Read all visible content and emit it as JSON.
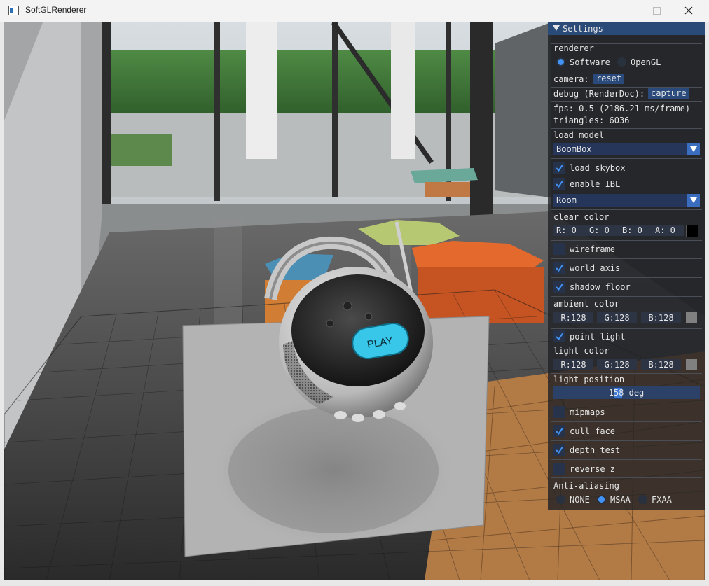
{
  "window": {
    "title": "SoftGLRenderer"
  },
  "settings": {
    "title": "Settings",
    "renderer": {
      "label": "renderer",
      "options": [
        {
          "label": "Software",
          "selected": true
        },
        {
          "label": "OpenGL",
          "selected": false
        }
      ]
    },
    "camera": {
      "label": "camera:",
      "button": "reset"
    },
    "debug": {
      "label": "debug (RenderDoc):",
      "button": "capture"
    },
    "fps": "fps: 0.5 (2186.21 ms/frame)",
    "triangles": "triangles: 6036",
    "load_model": {
      "label": "load model",
      "value": "BoomBox"
    },
    "load_skybox": {
      "label": "load skybox",
      "checked": true
    },
    "enable_ibl": {
      "label": "enable IBL",
      "checked": true
    },
    "skybox": {
      "value": "Room"
    },
    "clear_color": {
      "label": "clear color",
      "r": "R:  0",
      "g": "G:  0",
      "b": "B:  0",
      "a": "A:  0",
      "swatch": "#000000"
    },
    "wireframe": {
      "label": "wireframe",
      "checked": false
    },
    "world_axis": {
      "label": "world axis",
      "checked": true
    },
    "shadow_floor": {
      "label": "shadow floor",
      "checked": true
    },
    "ambient_color": {
      "label": "ambient color",
      "r": "R:128",
      "g": "G:128",
      "b": "B:128",
      "swatch": "#808080"
    },
    "point_light": {
      "label": "point light",
      "checked": true
    },
    "light_color": {
      "label": "light color",
      "r": "R:128",
      "g": "G:128",
      "b": "B:128",
      "swatch": "#808080"
    },
    "light_position": {
      "label": "light position",
      "value": "158 deg",
      "fraction": 0.44
    },
    "mipmaps": {
      "label": "mipmaps",
      "checked": false
    },
    "cull_face": {
      "label": "cull face",
      "checked": true
    },
    "depth_test": {
      "label": "depth test",
      "checked": true
    },
    "reverse_z": {
      "label": "reverse z",
      "checked": false
    },
    "anti_aliasing": {
      "label": "Anti-aliasing",
      "options": [
        {
          "label": "NONE",
          "selected": false
        },
        {
          "label": "MSAA",
          "selected": true
        },
        {
          "label": "FXAA",
          "selected": false
        }
      ]
    }
  },
  "scene": {
    "model_button_text": "PLAY",
    "accent": "#4293f5"
  }
}
